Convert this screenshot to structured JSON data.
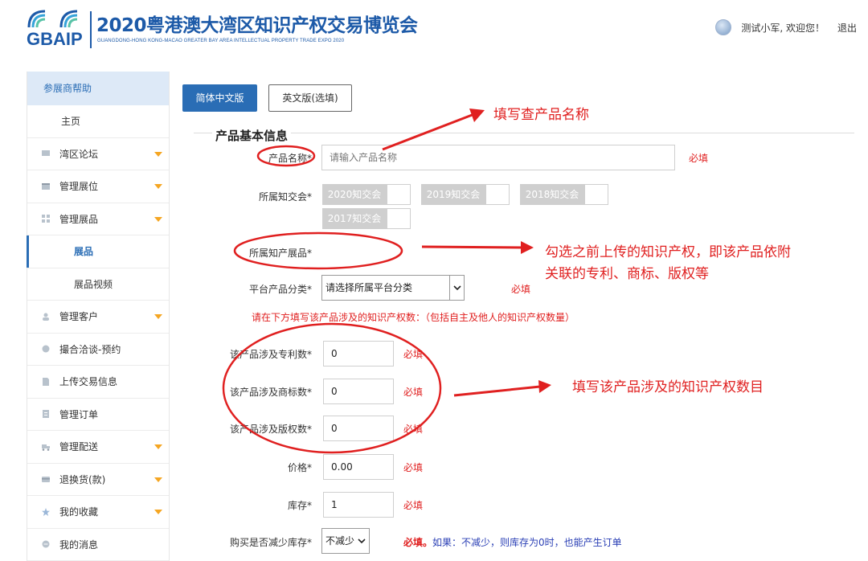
{
  "header": {
    "logo_text": "GBAIP",
    "title": "2020粤港澳大湾区知识产权交易博览会",
    "subtitle": "GUANGDONG-HONG KONG-MACAO GREATER BAY AREA INTELLECTUAL PROPERTY TRADE EXPO 2020",
    "welcome": "测试小军, 欢迎您！",
    "logout": "退出"
  },
  "sidebar": {
    "heading": "参展商帮助",
    "items": [
      {
        "label": "主页",
        "icon": "none"
      },
      {
        "label": "湾区论坛",
        "icon": "forum-icon",
        "expandable": true
      },
      {
        "label": "管理展位",
        "icon": "booth-icon",
        "expandable": true
      },
      {
        "label": "管理展品",
        "icon": "grid-icon",
        "expandable": true
      },
      {
        "label": "展品",
        "icon": "none",
        "active": true
      },
      {
        "label": "展品视频",
        "icon": "none"
      },
      {
        "label": "管理客户",
        "icon": "user-icon",
        "expandable": true
      },
      {
        "label": "撮合洽谈-预约",
        "icon": "chat-icon"
      },
      {
        "label": "上传交易信息",
        "icon": "upload-icon"
      },
      {
        "label": "管理订单",
        "icon": "order-icon"
      },
      {
        "label": "管理配送",
        "icon": "truck-icon",
        "expandable": true
      },
      {
        "label": "退换货(款)",
        "icon": "refund-icon",
        "expandable": true
      },
      {
        "label": "我的收藏",
        "icon": "star-icon",
        "expandable": true
      },
      {
        "label": "我的消息",
        "icon": "message-icon"
      }
    ]
  },
  "tabs": {
    "cn": "简体中文版",
    "en": "英文版(选填)"
  },
  "form": {
    "section_title": "产品基本信息",
    "product_name": {
      "label": "产品名称*",
      "placeholder": "请输入产品名称",
      "required": "必填"
    },
    "expo": {
      "label": "所属知交会*",
      "options": [
        "2020知交会",
        "2019知交会",
        "2018知交会",
        "2017知交会"
      ]
    },
    "ip_items": {
      "label": "所属知产展品*"
    },
    "category": {
      "label": "平台产品分类*",
      "value": "请选择所属平台分类",
      "required": "必填"
    },
    "hint": "请在下方填写该产品涉及的知识产权数：（包括自主及他人的知识产权数量）",
    "patents": {
      "label": "该产品涉及专利数*",
      "value": "0",
      "required": "必填"
    },
    "trademarks": {
      "label": "该产品涉及商标数*",
      "value": "0",
      "required": "必填"
    },
    "copyrights": {
      "label": "该产品涉及版权数*",
      "value": "0",
      "required": "必填"
    },
    "price": {
      "label": "价格*",
      "value": "0.00",
      "required": "必填"
    },
    "stock": {
      "label": "库存*",
      "value": "1",
      "required": "必填"
    },
    "reduce_stock": {
      "label": "购买是否减少库存*",
      "value": "不减少",
      "required": "必填。",
      "note": "如果：不减少，则库存为0时，也能产生订单"
    }
  },
  "annotations": {
    "a1": "填写查产品名称",
    "a2_line1": "勾选之前上传的知识产权，即该产品依附",
    "a2_line2": "关联的专利、商标、版权等",
    "a3": "填写该产品涉及的知识产权数目"
  },
  "colors": {
    "accent": "#2a6db5",
    "required_red": "#e02020",
    "annotation_red": "#e02020"
  }
}
